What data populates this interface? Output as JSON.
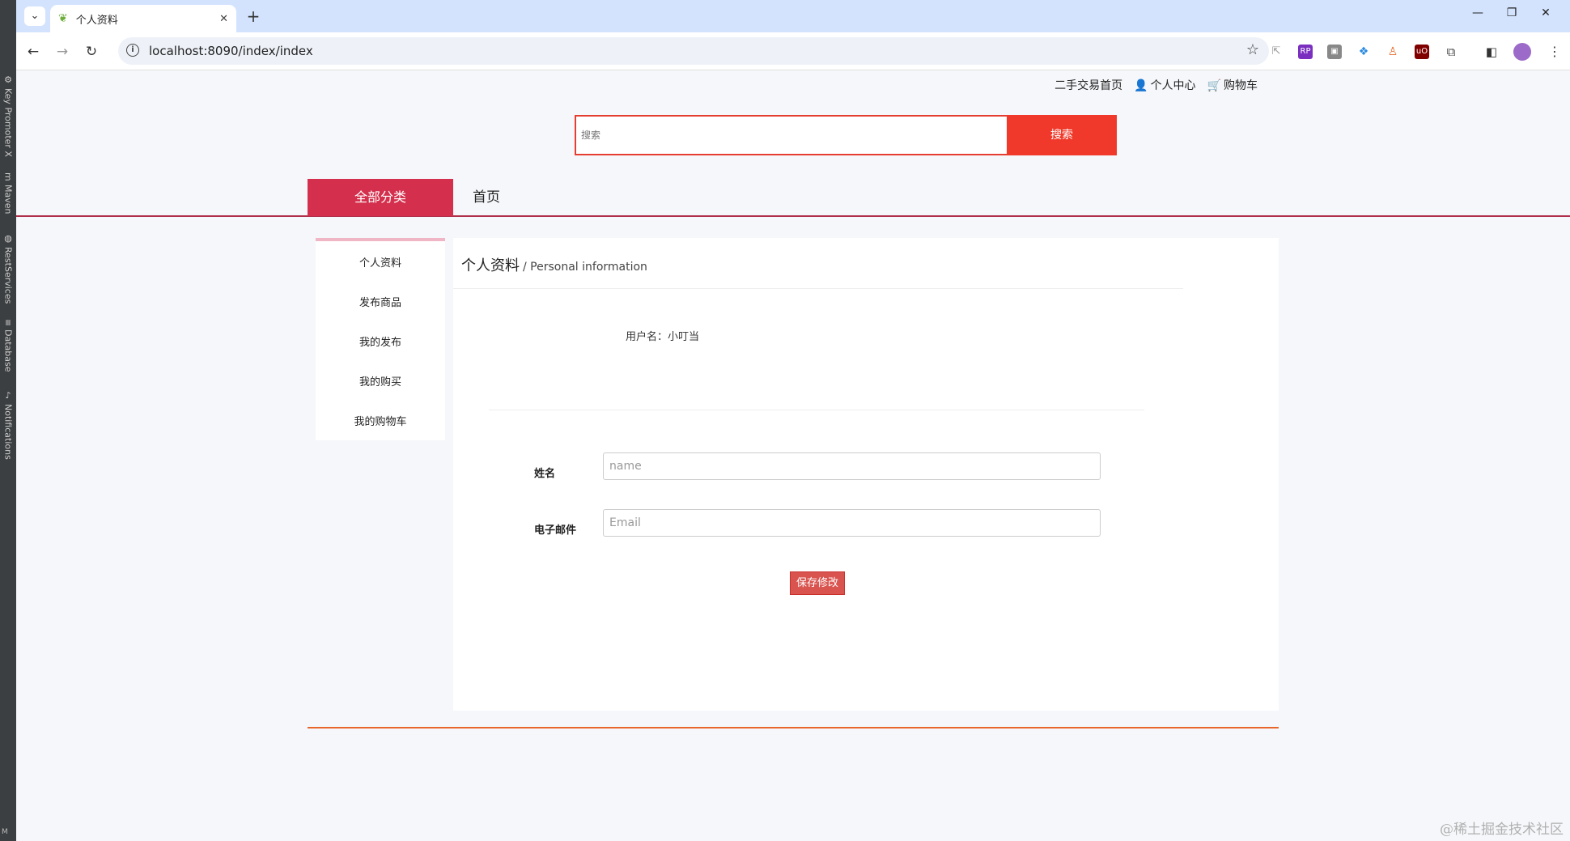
{
  "ide_strip": {
    "items": [
      "Key Promoter X",
      "Maven",
      "RestServices",
      "Database",
      "Notifications"
    ]
  },
  "browser": {
    "tab_title": "个人资料",
    "url": "localhost:8090/index/index"
  },
  "top_links": {
    "home": "二手交易首页",
    "user_center": "个人中心",
    "cart": "购物车"
  },
  "search": {
    "placeholder": "搜索",
    "button": "搜索"
  },
  "nav": {
    "all_categories": "全部分类",
    "home": "首页"
  },
  "sidebar": {
    "items": [
      "个人资料",
      "发布商品",
      "我的发布",
      "我的购买",
      "我的购物车"
    ]
  },
  "content": {
    "title_zh": "个人资料",
    "title_en": "/ Personal information",
    "username_label": "用户名：小叮当",
    "name_label": "姓名",
    "name_placeholder": "name",
    "email_label": "电子邮件",
    "email_placeholder": "Email",
    "save_button": "保存修改"
  },
  "watermark": "@稀土掘金技术社区",
  "colors": {
    "accent_red": "#f0392a",
    "nav_red": "#d42f4c",
    "save_red": "#d9534f",
    "footer_orange": "#e8662c"
  }
}
